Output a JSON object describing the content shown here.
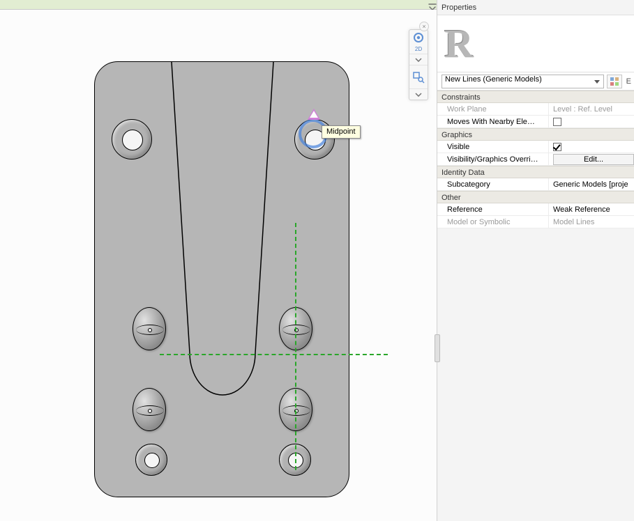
{
  "snap": {
    "label": "Midpoint"
  },
  "navbar": {
    "viewMode": "2D"
  },
  "properties": {
    "title": "Properties",
    "typeSelector": "New Lines (Generic Models)",
    "editTypeHint": "Edit Type",
    "sections": {
      "constraints": {
        "header": "Constraints",
        "workPlane": {
          "label": "Work Plane",
          "value": "Level : Ref. Level"
        },
        "movesWith": {
          "label": "Moves With Nearby Ele…",
          "checked": false
        }
      },
      "graphics": {
        "header": "Graphics",
        "visible": {
          "label": "Visible",
          "checked": true
        },
        "visOverrides": {
          "label": "Visibility/Graphics Overri…",
          "buttonLabel": "Edit..."
        }
      },
      "identity": {
        "header": "Identity Data",
        "subcategory": {
          "label": "Subcategory",
          "value": "Generic Models [proje"
        }
      },
      "other": {
        "header": "Other",
        "reference": {
          "label": "Reference",
          "value": "Weak Reference"
        },
        "modelSymbolic": {
          "label": "Model or Symbolic",
          "value": "Model Lines"
        }
      }
    }
  }
}
